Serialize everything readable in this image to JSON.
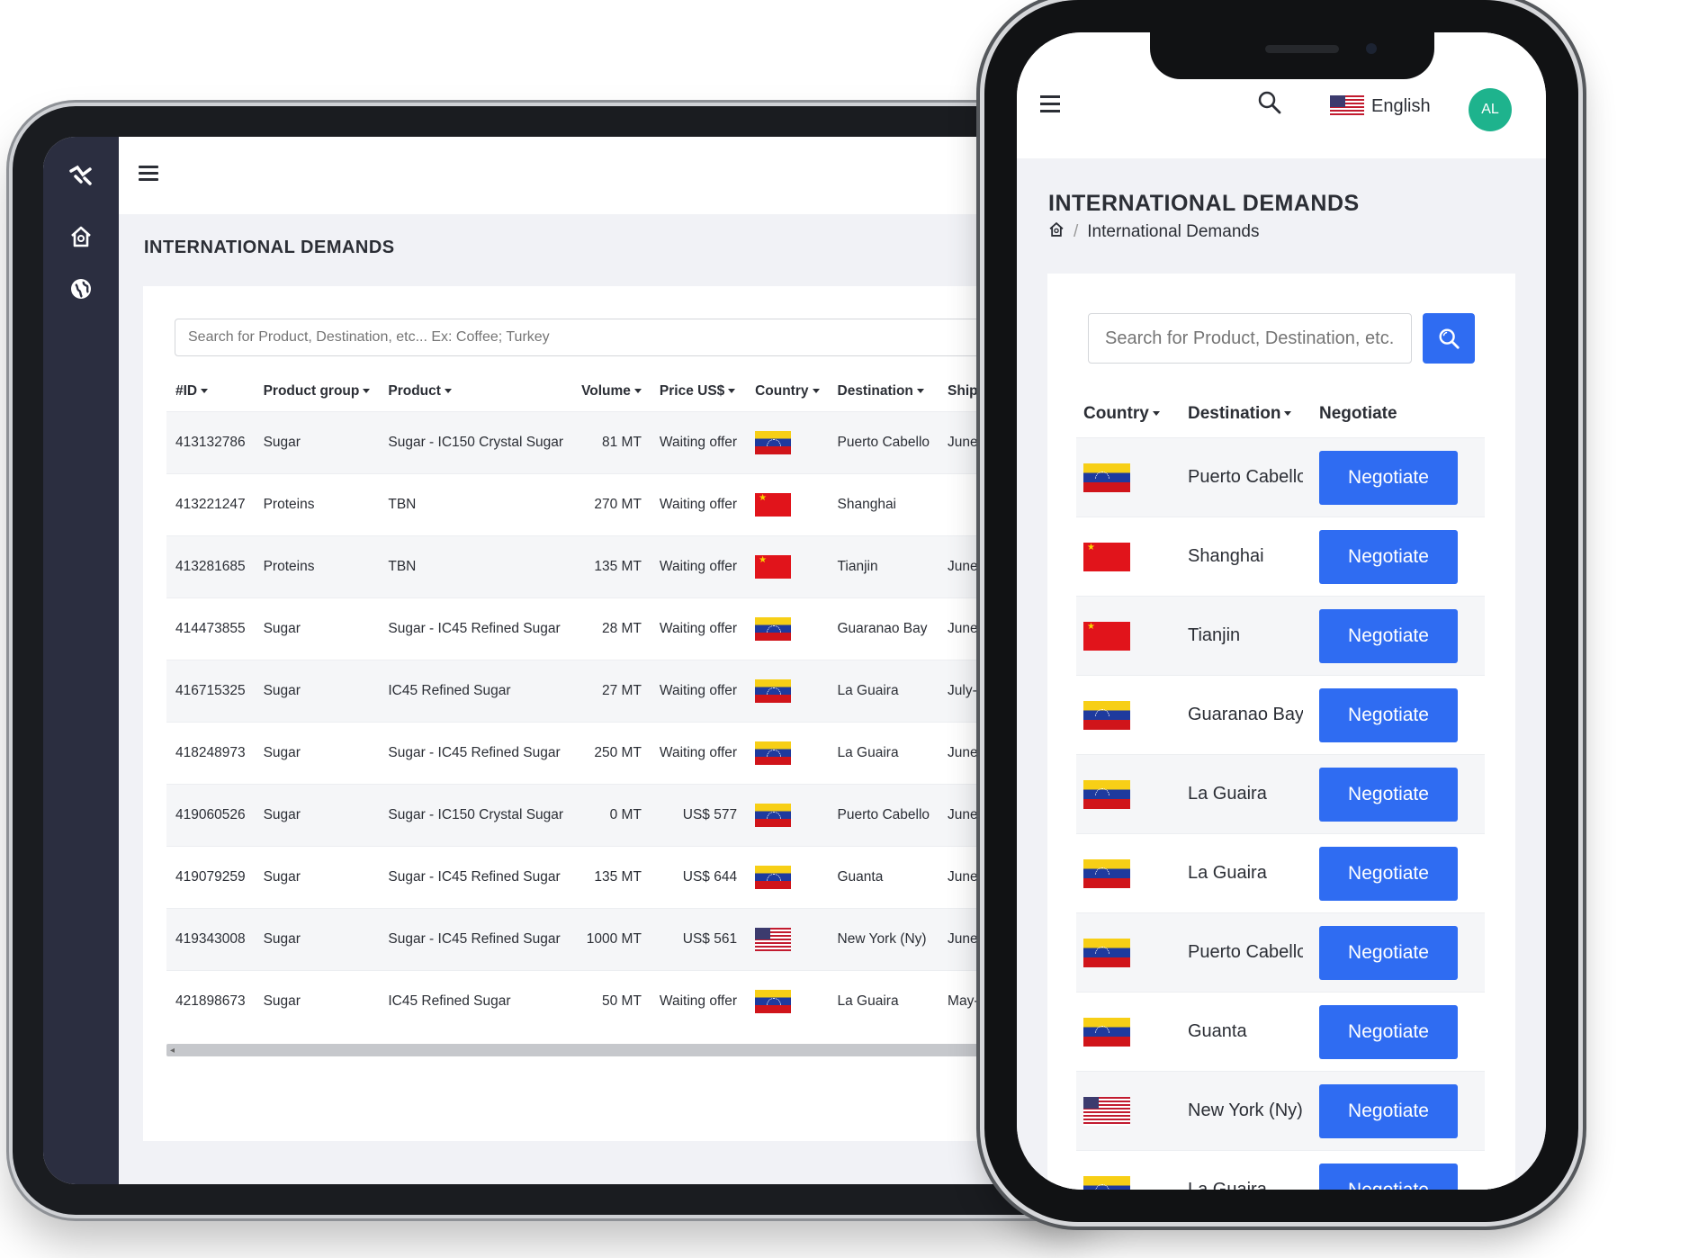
{
  "tablet": {
    "page_title": "INTERNATIONAL DEMANDS",
    "search_placeholder": "Search for Product, Destination, etc... Ex: Coffee; Turkey",
    "columns": [
      "#ID",
      "Product group",
      "Product",
      "Volume",
      "Price US$",
      "Country",
      "Destination",
      "Ship"
    ],
    "rows": [
      {
        "id": "413132786",
        "group": "Sugar",
        "product": "Sugar - IC150 Crystal Sugar",
        "volume": "81 MT",
        "price": "Waiting offer",
        "flag": "ve",
        "destination": "Puerto Cabello",
        "ship": "June"
      },
      {
        "id": "413221247",
        "group": "Proteins",
        "product": "TBN",
        "volume": "270 MT",
        "price": "Waiting offer",
        "flag": "cn",
        "destination": "Shanghai",
        "ship": ""
      },
      {
        "id": "413281685",
        "group": "Proteins",
        "product": "TBN",
        "volume": "135 MT",
        "price": "Waiting offer",
        "flag": "cn",
        "destination": "Tianjin",
        "ship": "June"
      },
      {
        "id": "414473855",
        "group": "Sugar",
        "product": "Sugar - IC45 Refined Sugar",
        "volume": "28 MT",
        "price": "Waiting offer",
        "flag": "ve",
        "destination": "Guaranao Bay",
        "ship": "June"
      },
      {
        "id": "416715325",
        "group": "Sugar",
        "product": "IC45 Refined Sugar",
        "volume": "27 MT",
        "price": "Waiting offer",
        "flag": "ve",
        "destination": "La Guaira",
        "ship": "July-"
      },
      {
        "id": "418248973",
        "group": "Sugar",
        "product": "Sugar - IC45 Refined Sugar",
        "volume": "250 MT",
        "price": "Waiting offer",
        "flag": "ve",
        "destination": "La Guaira",
        "ship": "June"
      },
      {
        "id": "419060526",
        "group": "Sugar",
        "product": "Sugar - IC150 Crystal Sugar",
        "volume": "0 MT",
        "price": "US$ 577",
        "flag": "ve",
        "destination": "Puerto Cabello",
        "ship": "June"
      },
      {
        "id": "419079259",
        "group": "Sugar",
        "product": "Sugar - IC45 Refined Sugar",
        "volume": "135 MT",
        "price": "US$ 644",
        "flag": "ve",
        "destination": "Guanta",
        "ship": "June"
      },
      {
        "id": "419343008",
        "group": "Sugar",
        "product": "Sugar - IC45 Refined Sugar",
        "volume": "1000 MT",
        "price": "US$ 561",
        "flag": "us",
        "destination": "New York (Ny)",
        "ship": "June"
      },
      {
        "id": "421898673",
        "group": "Sugar",
        "product": "IC45 Refined Sugar",
        "volume": "50 MT",
        "price": "Waiting offer",
        "flag": "ve",
        "destination": "La Guaira",
        "ship": "May-"
      }
    ]
  },
  "phone": {
    "language": "English",
    "avatar_initials": "AL",
    "page_title": "INTERNATIONAL DEMANDS",
    "breadcrumb": "International Demands",
    "search_placeholder": "Search for Product, Destination, etc... Ex: Coffee; Turkey",
    "columns": [
      "Country",
      "Destination",
      "Negotiate"
    ],
    "negotiate_label": "Negotiate",
    "rows": [
      {
        "flag": "ve",
        "destination": "Puerto Cabello"
      },
      {
        "flag": "cn",
        "destination": "Shanghai"
      },
      {
        "flag": "cn",
        "destination": "Tianjin"
      },
      {
        "flag": "ve",
        "destination": "Guaranao Bay"
      },
      {
        "flag": "ve",
        "destination": "La Guaira"
      },
      {
        "flag": "ve",
        "destination": "La Guaira"
      },
      {
        "flag": "ve",
        "destination": "Puerto Cabello"
      },
      {
        "flag": "ve",
        "destination": "Guanta"
      },
      {
        "flag": "us",
        "destination": "New York (Ny)"
      },
      {
        "flag": "ve",
        "destination": "La Guaira"
      }
    ]
  },
  "colors": {
    "primary": "#2f6cf2",
    "sidebar": "#2b2e40",
    "avatar": "#1eb38d",
    "background": "#f1f2f6"
  },
  "icons": [
    "logo-icon",
    "home-icon",
    "globe-icon",
    "hamburger-icon",
    "search-icon",
    "us-flag-icon"
  ]
}
